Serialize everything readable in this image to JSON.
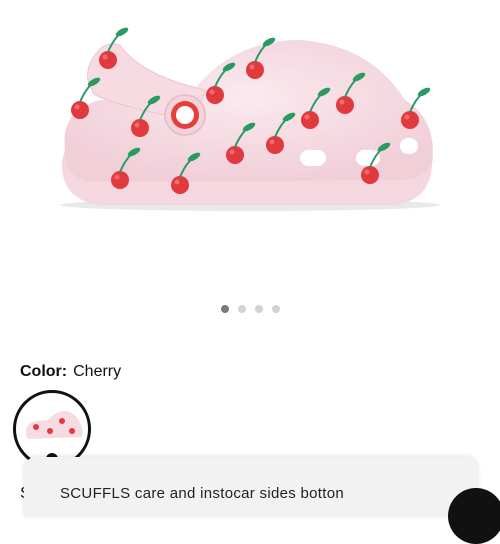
{
  "product": {
    "image_alt": "Cherry print kids clog",
    "colors": {
      "primary": "#f7dde4",
      "cherry": "#e0393e",
      "leaf": "#2a9a63"
    }
  },
  "carousel": {
    "total": 4,
    "active": 1
  },
  "color_selector": {
    "label": "Color:",
    "value": "Cherry"
  },
  "size_label_partial": "S",
  "bottom_panel": {
    "text": "SCUFFLS care and instocar sides botton"
  }
}
